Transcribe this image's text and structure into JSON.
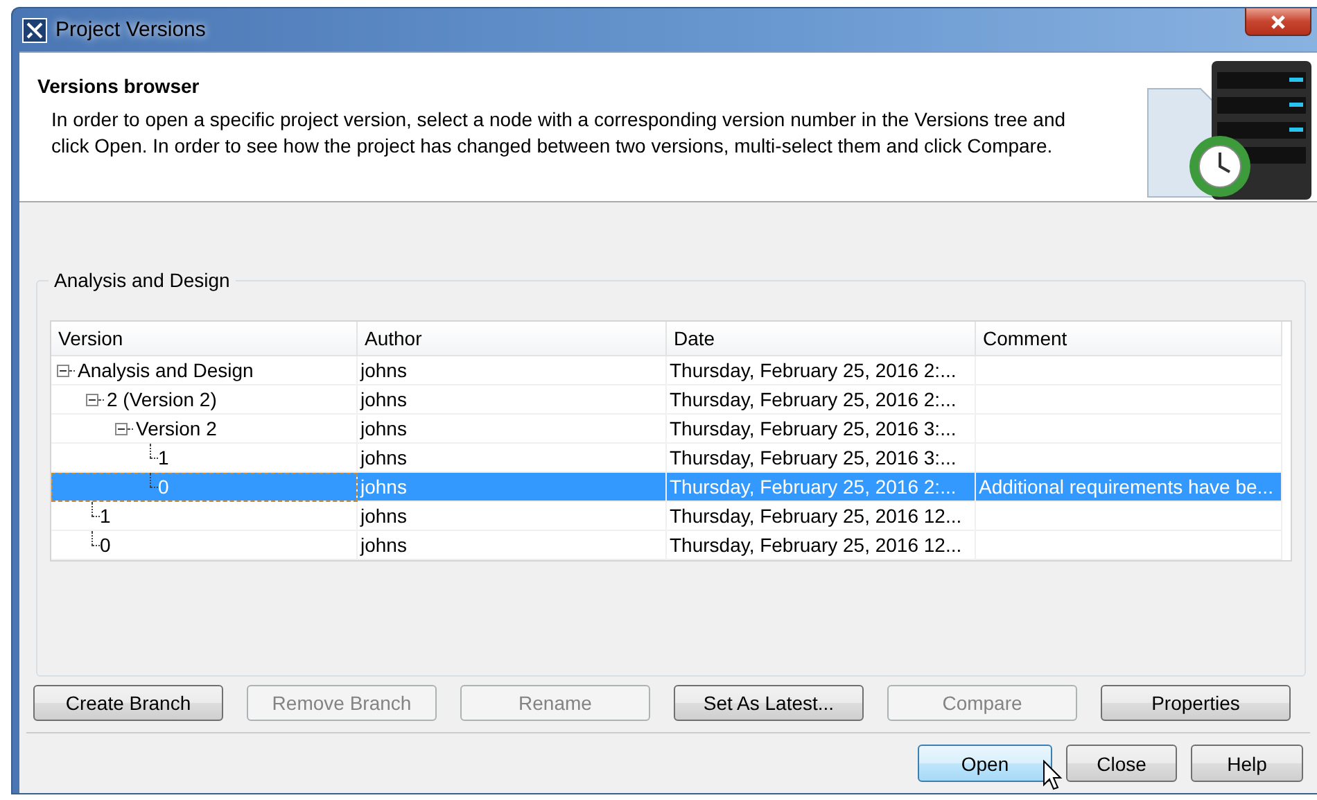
{
  "window": {
    "title": "Project Versions"
  },
  "header": {
    "title": "Versions browser",
    "description": "In order to open a specific project version, select a node with a corresponding version number in the Versions tree and click Open. In order to see how the project has changed between two versions, multi-select them and click Compare."
  },
  "group": {
    "title": "Analysis and Design",
    "columns": [
      "Version",
      "Author",
      "Date",
      "Comment"
    ],
    "rows": [
      {
        "version": "Analysis and Design",
        "author": "johns",
        "date": "Thursday, February 25, 2016 2:...",
        "selected": false,
        "expanded": true,
        "children": [
          {
            "version": "2 (Version 2)",
            "author": "johns",
            "date": "Thursday, February 25, 2016 2:...",
            "selected": false,
            "expanded": true,
            "children": [
              {
                "version": "Version 2",
                "author": "johns",
                "date": "Thursday, February 25, 2016 3:...",
                "selected": false,
                "expanded": true,
                "children": [
                  {
                    "version": "1",
                    "author": "johns",
                    "date": "Thursday, February 25, 2016 3:...",
                    "selected": false
                  },
                  {
                    "version": "0",
                    "author": "johns",
                    "date": "Thursday, February 25, 2016 2:...",
                    "comment": "Additional requirements have be...",
                    "selected": true
                  }
                ]
              }
            ]
          },
          {
            "version": "1",
            "author": "johns",
            "date": "Thursday, February 25, 2016 12...",
            "selected": false
          },
          {
            "version": "0",
            "author": "johns",
            "date": "Thursday, February 25, 2016 12...",
            "selected": false
          }
        ]
      }
    ]
  },
  "actions": [
    {
      "label": "Create Branch",
      "disabled": false
    },
    {
      "label": "Remove Branch",
      "disabled": true
    },
    {
      "label": "Rename",
      "disabled": true
    },
    {
      "label": "Set As Latest...",
      "disabled": false
    },
    {
      "label": "Compare",
      "disabled": true
    },
    {
      "label": "Properties",
      "disabled": false
    }
  ],
  "dialog_buttons": [
    {
      "label": "Open",
      "focused": true
    },
    {
      "label": "Close",
      "focused": false
    },
    {
      "label": "Help",
      "focused": false
    }
  ]
}
